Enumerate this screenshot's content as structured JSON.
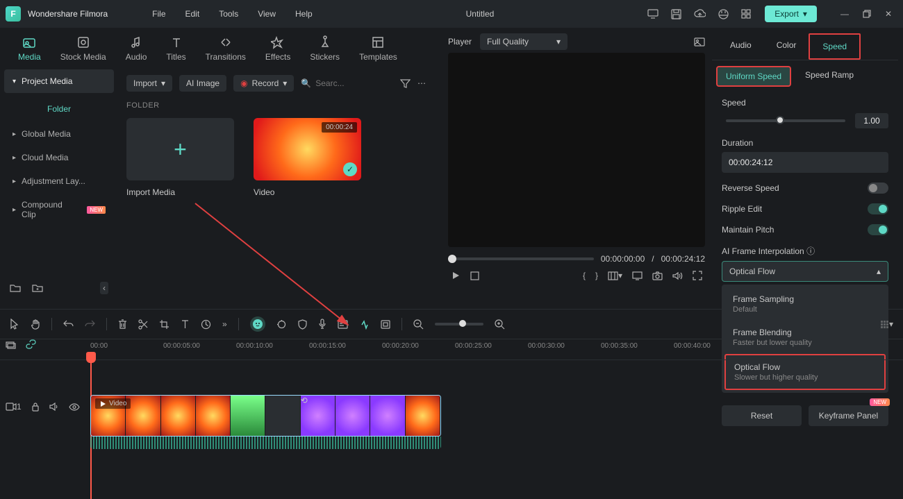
{
  "app": {
    "name": "Wondershare Filmora",
    "title": "Untitled"
  },
  "menu": [
    "File",
    "Edit",
    "Tools",
    "View",
    "Help"
  ],
  "export_label": "Export",
  "nav_tabs": [
    {
      "label": "Media",
      "active": true
    },
    {
      "label": "Stock Media"
    },
    {
      "label": "Audio"
    },
    {
      "label": "Titles"
    },
    {
      "label": "Transitions"
    },
    {
      "label": "Effects"
    },
    {
      "label": "Stickers"
    },
    {
      "label": "Templates"
    }
  ],
  "toolbar": {
    "import": "Import",
    "ai_image": "AI Image",
    "record": "Record",
    "search": "Searc..."
  },
  "sidebar": {
    "head": "Project Media",
    "sub": "Folder",
    "items": [
      "Global Media",
      "Cloud Media",
      "Adjustment Lay...",
      "Compound Clip"
    ]
  },
  "folder_label": "FOLDER",
  "media": {
    "import_label": "Import Media",
    "video_label": "Video",
    "video_duration": "00:00:24"
  },
  "player": {
    "label": "Player",
    "quality": "Full Quality",
    "current": "00:00:00:00",
    "total": "00:00:24:12"
  },
  "props": {
    "tabs": [
      "Audio",
      "Color",
      "Speed"
    ],
    "subtabs": [
      "Uniform Speed",
      "Speed Ramp"
    ],
    "speed_label": "Speed",
    "speed_value": "1.00",
    "duration_label": "Duration",
    "duration_value": "00:00:24:12",
    "reverse_label": "Reverse Speed",
    "ripple_label": "Ripple Edit",
    "pitch_label": "Maintain Pitch",
    "interp_label": "AI Frame Interpolation",
    "interp_value": "Optical Flow",
    "options": [
      {
        "title": "Frame Sampling",
        "sub": "Default"
      },
      {
        "title": "Frame Blending",
        "sub": "Faster but lower quality"
      },
      {
        "title": "Optical Flow",
        "sub": "Slower but higher quality"
      }
    ],
    "reset": "Reset",
    "keyframe": "Keyframe Panel"
  },
  "timeline": {
    "ticks": [
      "00:00",
      "00:00:05:00",
      "00:00:10:00",
      "00:00:15:00",
      "00:00:20:00",
      "00:00:25:00",
      "00:00:30:00",
      "00:00:35:00",
      "00:00:40:00"
    ],
    "clip_label": "Video"
  }
}
